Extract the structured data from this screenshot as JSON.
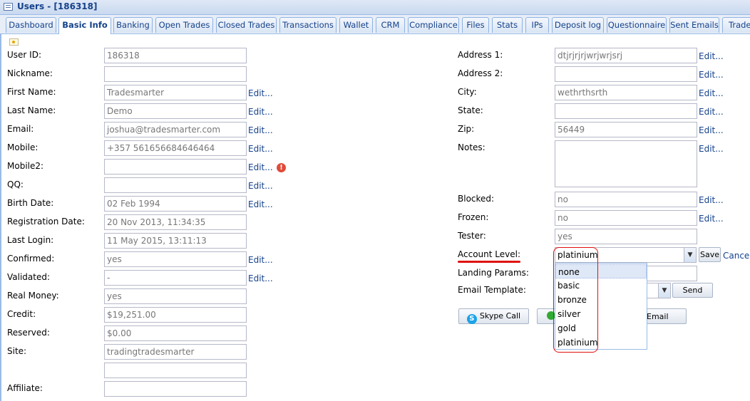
{
  "window": {
    "title": "Users - [186318]"
  },
  "tabs": [
    "Dashboard",
    "Basic Info",
    "Banking",
    "Open Trades",
    "Closed Trades",
    "Transactions",
    "Wallet",
    "CRM",
    "Compliance",
    "Files",
    "Stats",
    "IPs",
    "Deposit log",
    "Questionnaire",
    "Sent Emails",
    "Trade"
  ],
  "active_tab": "Basic Info",
  "edit_label": "Edit...",
  "left": {
    "user_id": {
      "label": "User ID:",
      "value": "186318"
    },
    "nickname": {
      "label": "Nickname:",
      "value": ""
    },
    "first_name": {
      "label": "First Name:",
      "value": "Tradesmarter"
    },
    "last_name": {
      "label": "Last Name:",
      "value": "Demo"
    },
    "email": {
      "label": "Email:",
      "value": "joshua@tradesmarter.com"
    },
    "mobile": {
      "label": "Mobile:",
      "value": "+357 561656684646464"
    },
    "mobile2": {
      "label": "Mobile2:",
      "value": ""
    },
    "qq": {
      "label": "QQ:",
      "value": ""
    },
    "birth_date": {
      "label": "Birth Date:",
      "value": "02 Feb 1994"
    },
    "registration_date": {
      "label": "Registration Date:",
      "value": "20 Nov 2013, 11:34:35"
    },
    "last_login": {
      "label": "Last Login:",
      "value": "11 May 2015, 13:11:13"
    },
    "confirmed": {
      "label": "Confirmed:",
      "value": "yes"
    },
    "validated": {
      "label": "Validated:",
      "value": "-"
    },
    "real_money": {
      "label": "Real Money:",
      "value": "yes"
    },
    "credit": {
      "label": "Credit:",
      "value": "$19,251.00"
    },
    "reserved": {
      "label": "Reserved:",
      "value": "$0.00"
    },
    "site": {
      "label": "Site:",
      "value": "tradingtradesmarter"
    },
    "site2": {
      "value": ""
    },
    "affiliate": {
      "label": "Affiliate:",
      "value": ""
    }
  },
  "right": {
    "address1": {
      "label": "Address 1:",
      "value": "dtjrjrjrjwrjwrjsrj"
    },
    "address2": {
      "label": "Address 2:",
      "value": ""
    },
    "city": {
      "label": "City:",
      "value": "wethrthsrth"
    },
    "state": {
      "label": "State:",
      "value": ""
    },
    "zip": {
      "label": "Zip:",
      "value": "56449"
    },
    "notes": {
      "label": "Notes:",
      "value": ""
    },
    "blocked": {
      "label": "Blocked:",
      "value": "no"
    },
    "frozen": {
      "label": "Frozen:",
      "value": "no"
    },
    "tester": {
      "label": "Tester:",
      "value": "yes"
    },
    "account_level": {
      "label": "Account Level:",
      "value": "platinium",
      "options": [
        "none",
        "basic",
        "bronze",
        "silver",
        "gold",
        "platinium"
      ],
      "highlighted": "none"
    },
    "landing_params": {
      "label": "Landing Params:",
      "value": ""
    },
    "email_template": {
      "label": "Email Template:",
      "value": ""
    }
  },
  "buttons": {
    "save": "Save",
    "cancel": "Cancel",
    "send": "Send",
    "skype": "Skype Call",
    "email": "Email"
  },
  "colors": {
    "accent": "#15428b",
    "highlight_red": "#e01010"
  }
}
